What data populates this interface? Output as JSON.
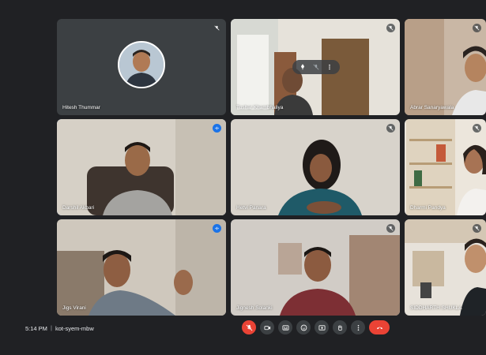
{
  "meeting": {
    "time": "5:14 PM",
    "separator": "|",
    "code": "kot-syem-mbw"
  },
  "participants": [
    {
      "name": "Hitesh Thummar",
      "mic": "muted",
      "type": "avatar"
    },
    {
      "name": "Tushar Khambhaliya",
      "mic": "muted",
      "pinned_overlay": true
    },
    {
      "name": "Abrar Sanaryawala",
      "mic": "muted"
    },
    {
      "name": "Darshil Akbari",
      "mic": "speaking"
    },
    {
      "name": "Hetvi Panara",
      "mic": "muted"
    },
    {
      "name": "Dharmi Pandya",
      "mic": "muted"
    },
    {
      "name": "Jigs Virani",
      "mic": "speaking"
    },
    {
      "name": "Jignesh Solanki",
      "mic": "muted"
    },
    {
      "name": "SIDDHARTH SHUKLA",
      "mic": "muted"
    }
  ],
  "controls": [
    "mic-off-icon",
    "camera-icon",
    "captions-icon",
    "emoji-icon",
    "present-icon",
    "raise-hand-icon",
    "more-options-icon",
    "end-call-icon"
  ],
  "colors": {
    "background": "#202124",
    "tile": "#3c4043",
    "accent": "#1a73e8",
    "danger": "#ea4335"
  }
}
